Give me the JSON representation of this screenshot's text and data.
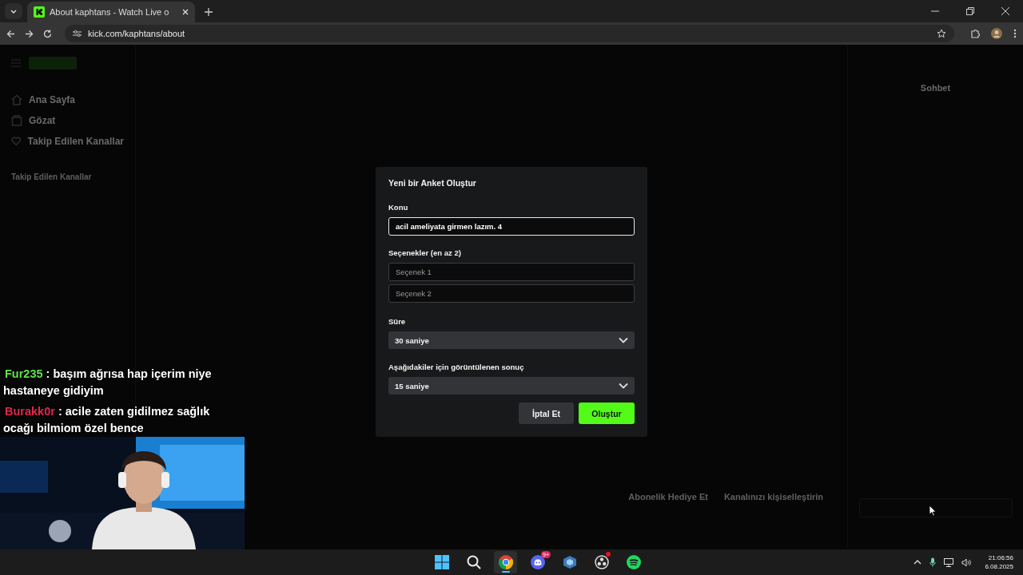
{
  "browser": {
    "tab": {
      "title": "About kaphtans - Watch Live o",
      "selected": true
    },
    "address": "kick.com/kaphtans/about"
  },
  "sidebar": {
    "items": [
      {
        "label": "Ana Sayfa",
        "kind": "home"
      },
      {
        "label": "Gözat",
        "kind": "browse"
      },
      {
        "label": "Takip Edilen Kanallar",
        "kind": "heart"
      }
    ],
    "section_title": "Takip Edilen Kanallar"
  },
  "chat": {
    "title": "Sohbet"
  },
  "channel_actions": [
    "Abonelik Hediye Et",
    "Kanalınızı kişiselleştirin"
  ],
  "modal": {
    "title": "Yeni bir Anket Oluştur",
    "topic": {
      "label": "Konu",
      "value": "acil ameliyata girmen lazım. 4"
    },
    "options": {
      "label": "Seçenekler (en az 2)",
      "placeholders": [
        "Seçenek 1",
        "Seçenek 2"
      ]
    },
    "duration": {
      "label": "Süre",
      "value": "30 saniye"
    },
    "result": {
      "label": "Aşağıdakiler için görüntülenen sonuç",
      "value": "15 saniye"
    },
    "buttons": [
      {
        "label": "İptal Et",
        "kind": "secondary"
      },
      {
        "label": "Oluştur",
        "kind": "primary"
      }
    ]
  },
  "stream_overlay": {
    "messages": [
      {
        "user": "Fur235",
        "color": "#5fe34a",
        "text": ": başım ağrısa hap içerim niye hastaneye gidiyim"
      },
      {
        "user": "Burakk0r",
        "color": "#e0284e",
        "text": ": acile zaten gidilmez sağlık ocağı bilmiom özel bence"
      }
    ]
  },
  "taskbar": {
    "apps": [
      {
        "kind": "start",
        "selected": false
      },
      {
        "kind": "search",
        "selected": false
      },
      {
        "kind": "chrome",
        "selected": true
      },
      {
        "kind": "discord",
        "selected": false,
        "badge": "9+"
      },
      {
        "kind": "cube",
        "selected": false
      },
      {
        "kind": "obs",
        "selected": false,
        "dot": true
      },
      {
        "kind": "spotify",
        "selected": false
      }
    ],
    "time": "21:06:56",
    "date": "6.08.2025"
  }
}
